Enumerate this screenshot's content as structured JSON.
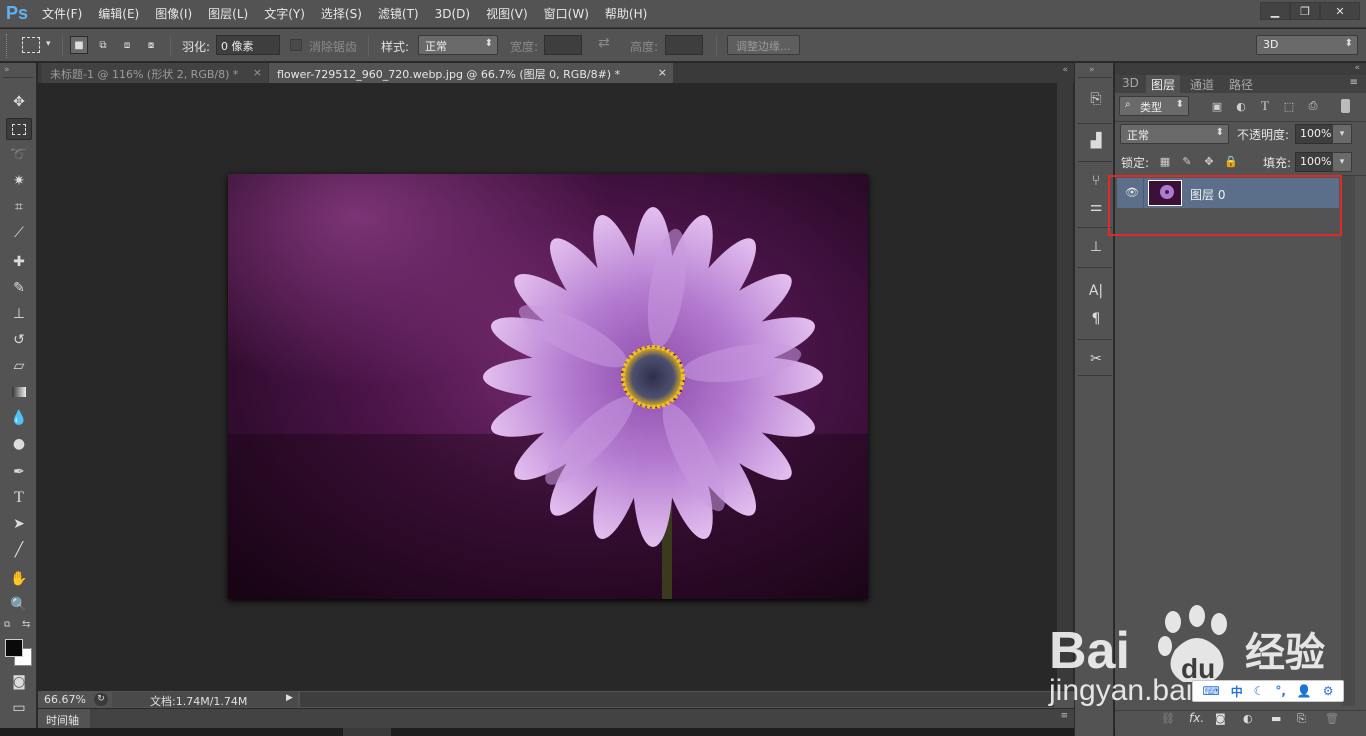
{
  "app": {
    "logo": "Ps",
    "menu": [
      "文件(F)",
      "编辑(E)",
      "图像(I)",
      "图层(L)",
      "文字(Y)",
      "选择(S)",
      "滤镜(T)",
      "3D(D)",
      "视图(V)",
      "窗口(W)",
      "帮助(H)"
    ],
    "window_buttons": [
      "minimize-icon",
      "restore-icon",
      "close-icon"
    ]
  },
  "options": {
    "feather_label": "羽化:",
    "feather_value": "0 像素",
    "antialias_label": "消除锯齿",
    "style_label": "样式:",
    "style_value": "正常",
    "width_label": "宽度:",
    "height_label": "高度:",
    "refine_edge_label": "调整边缘...",
    "workspace_value": "3D"
  },
  "document_tabs": [
    {
      "label": "未标题-1 @ 116% (形状 2, RGB/8) *",
      "active": false
    },
    {
      "label": "flower-729512_960_720.webp.jpg @ 66.7% (图层 0, RGB/8#) *",
      "active": true
    }
  ],
  "tools": [
    "move-icon",
    "marquee-icon",
    "lasso-icon",
    "magic-wand-icon",
    "crop-icon",
    "eyedropper-icon",
    "healing-icon",
    "brush-icon",
    "stamp-icon",
    "history-brush-icon",
    "eraser-icon",
    "gradient-icon",
    "blur-icon",
    "dodge-icon",
    "pen-icon",
    "type-icon",
    "path-select-icon",
    "line-icon",
    "hand-icon",
    "zoom-icon"
  ],
  "status": {
    "zoom": "66.67%",
    "doc_info": "文档:1.74M/1.74M"
  },
  "timeline": {
    "label": "时间轴"
  },
  "panel": {
    "tabs": [
      "3D",
      "图层",
      "通道",
      "路径"
    ],
    "active_tab": "图层",
    "filter_kind": "类型",
    "blend_mode": "正常",
    "opacity_label": "不透明度:",
    "opacity_value": "100%",
    "lock_label": "锁定:",
    "fill_label": "填充:",
    "fill_value": "100%",
    "layers": [
      {
        "name": "图层 0",
        "visible": true,
        "selected": true
      }
    ]
  },
  "watermark": {
    "brand_text": "Bai",
    "brand_paw_text": "du",
    "brand_suffix": "经验",
    "url": "jingyan.baidu.com"
  },
  "ime": {
    "mode": "中",
    "items": [
      "keyboard-icon",
      "moon-icon",
      "punctuation-icon",
      "user-icon",
      "settings-icon"
    ]
  },
  "colors": {
    "ui_dark": "#535353",
    "canvas_bg": "#282828",
    "selection_blue": "#5b6f8a",
    "highlight_red": "#e02a2a",
    "logo_blue": "#5fb3f5"
  }
}
